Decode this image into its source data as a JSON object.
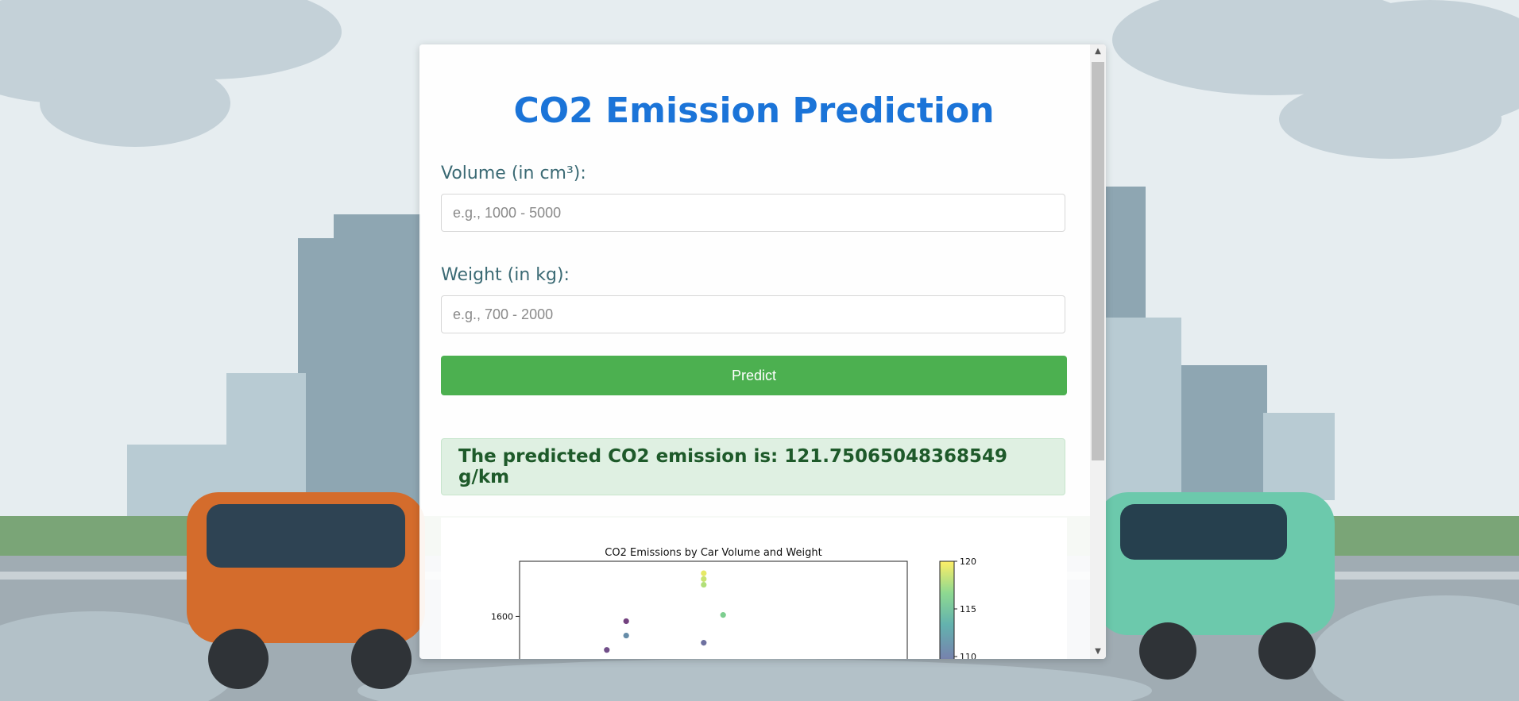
{
  "page": {
    "title": "CO2 Emission Prediction"
  },
  "form": {
    "volume_label": "Volume (in cm³):",
    "volume_placeholder": "e.g., 1000 - 5000",
    "volume_value": "",
    "weight_label": "Weight (in kg):",
    "weight_placeholder": "e.g., 700 - 2000",
    "weight_value": "",
    "predict_label": "Predict"
  },
  "result": {
    "text": "The predicted CO2 emission is: 121.75065048368549 g/km"
  },
  "colors": {
    "title": "#1b74d8",
    "button": "#4cb050",
    "result_bg": "#dff0e2",
    "result_text": "#1e5a2a"
  },
  "chart_data": {
    "type": "scatter",
    "title": "CO2 Emissions by Car Volume and Weight",
    "xlabel": "",
    "ylabel": "",
    "y_ticks": [
      1600
    ],
    "colorbar_ticks": [
      120,
      115,
      110
    ],
    "colorbar_range": [
      110,
      120
    ],
    "points": [
      {
        "x": 1.9,
        "y": 1690,
        "c": 119.5
      },
      {
        "x": 1.9,
        "y": 1678,
        "c": 118.9
      },
      {
        "x": 1.9,
        "y": 1666,
        "c": 118.4
      },
      {
        "x": 2.1,
        "y": 1603,
        "c": 117.0
      },
      {
        "x": 1.1,
        "y": 1590,
        "c": 105.0
      },
      {
        "x": 1.1,
        "y": 1560,
        "c": 113.3
      },
      {
        "x": 1.9,
        "y": 1545,
        "c": 112.0
      },
      {
        "x": 0.9,
        "y": 1530,
        "c": 110.6
      }
    ]
  }
}
